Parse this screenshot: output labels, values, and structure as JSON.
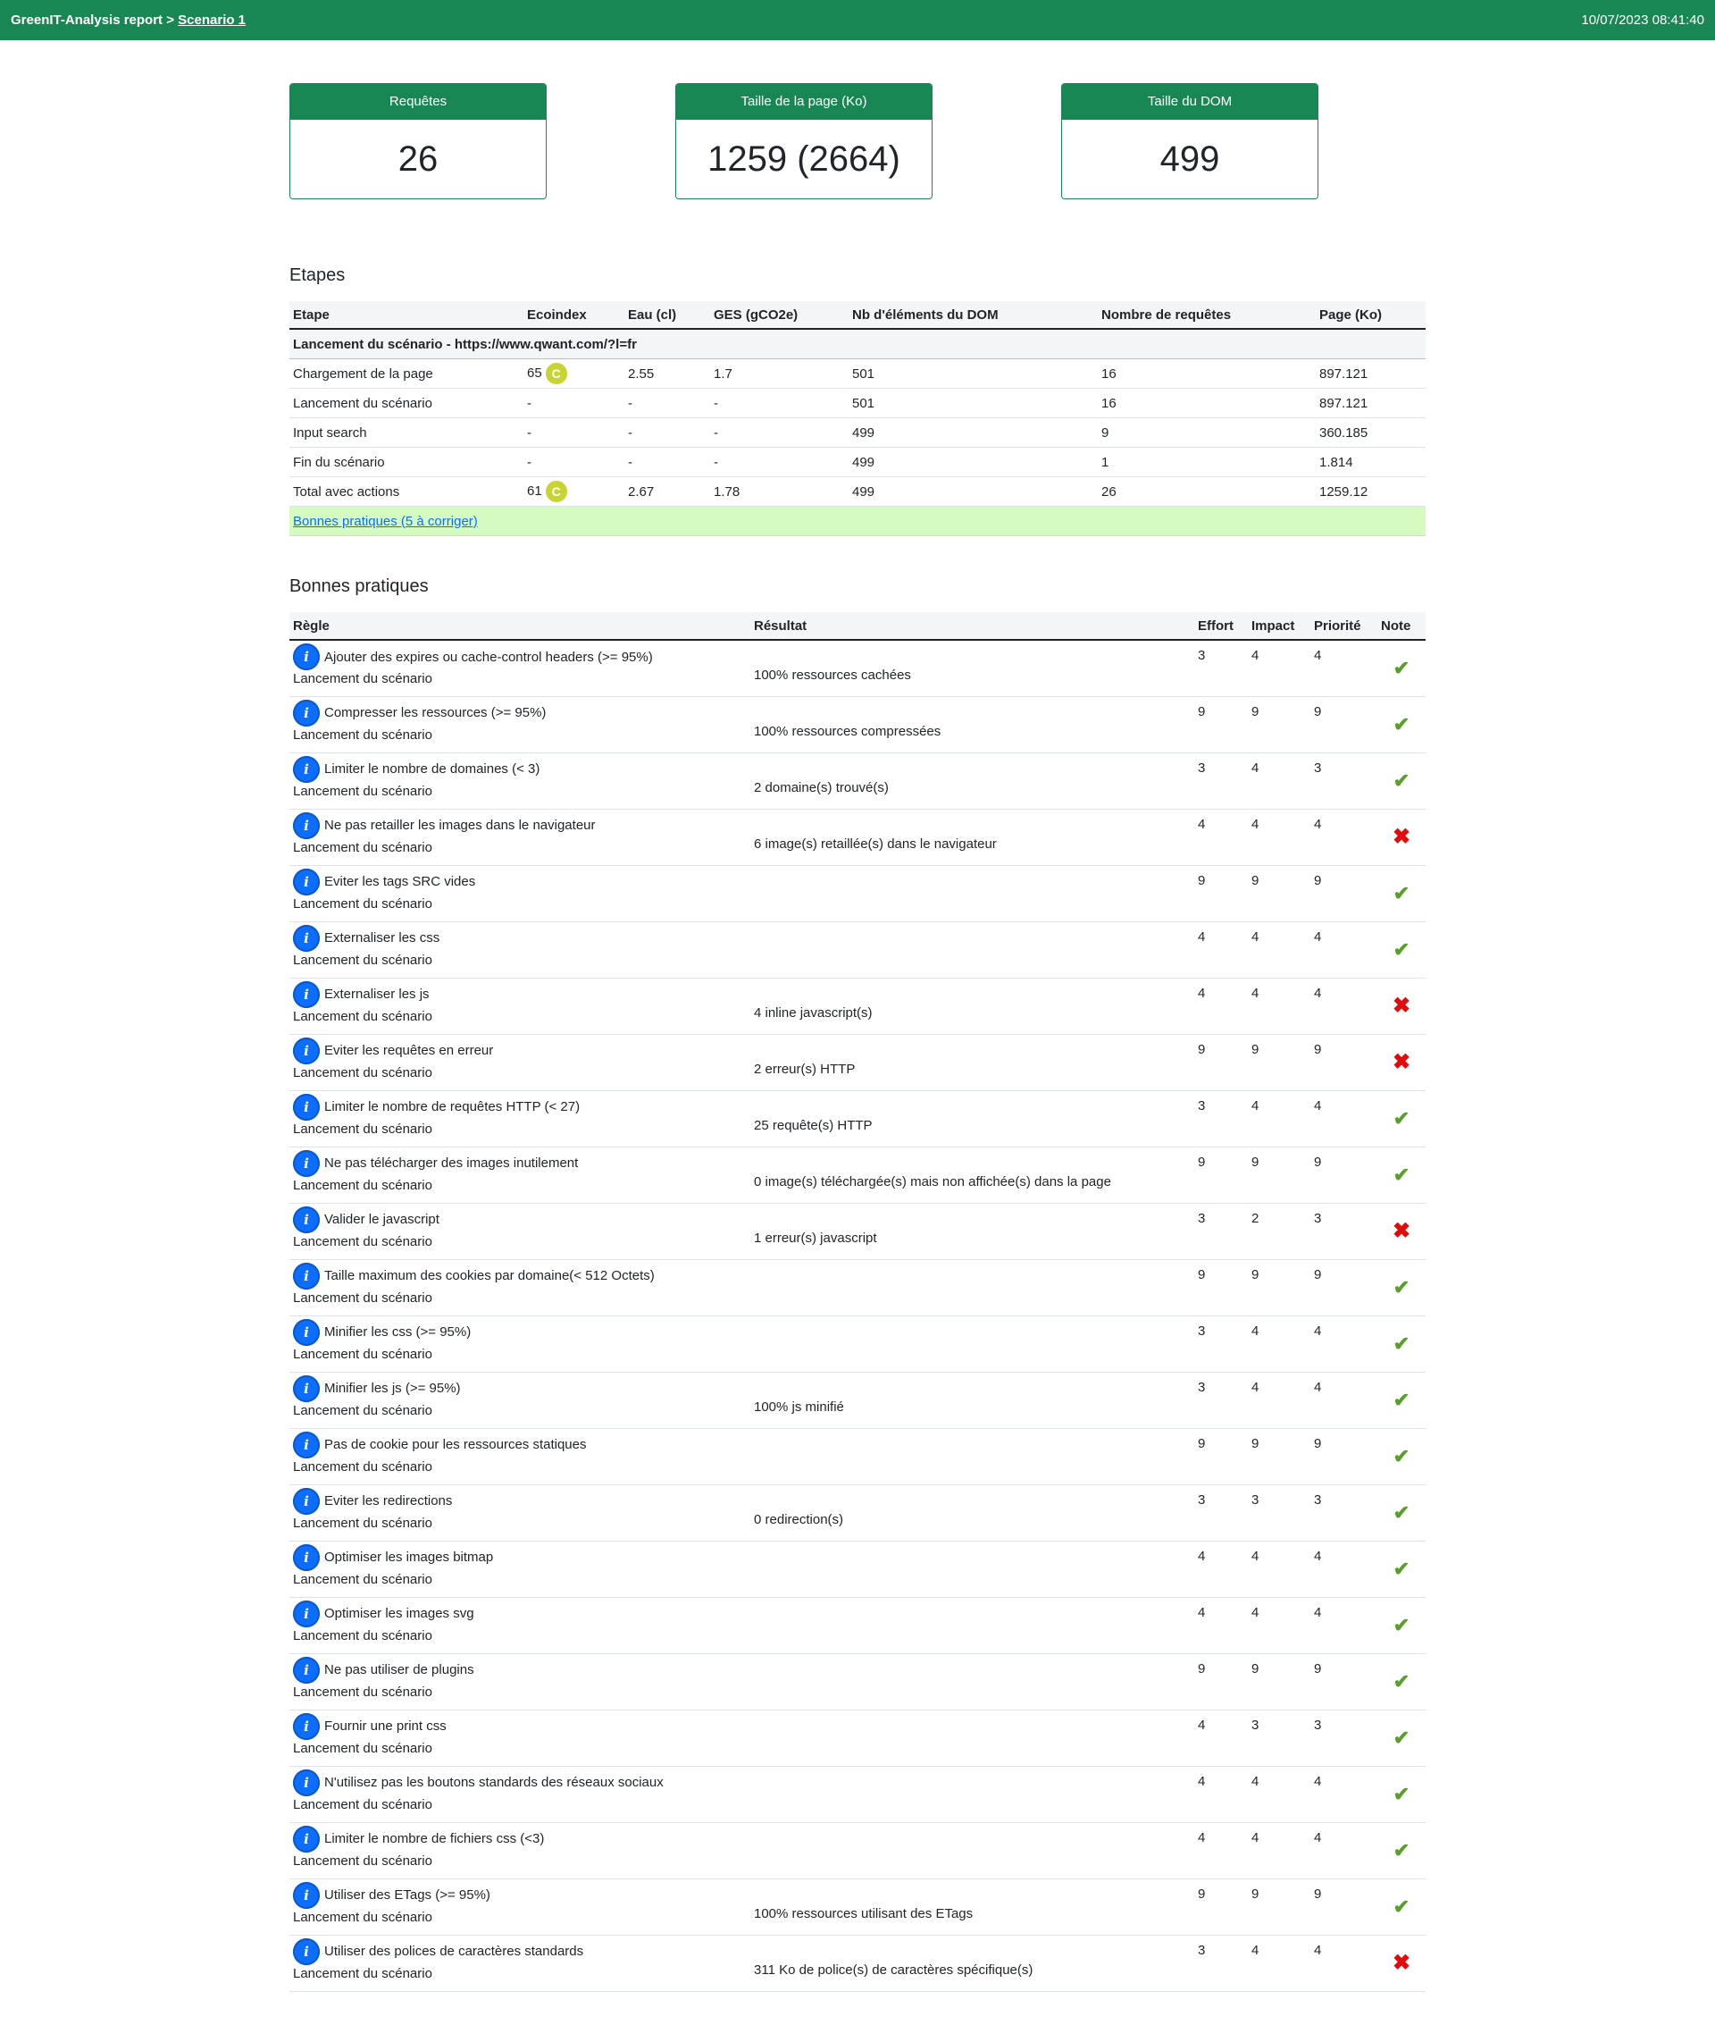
{
  "header": {
    "title": "GreenIT-Analysis report >",
    "scenario_link": "Scenario 1",
    "datetime": "10/07/2023 08:41:40"
  },
  "cards": {
    "requests": {
      "label": "Requêtes",
      "value": "26"
    },
    "page_size": {
      "label": "Taille de la page (Ko)",
      "value": "1259 (2664)"
    },
    "dom_size": {
      "label": "Taille du DOM",
      "value": "499"
    }
  },
  "etapes": {
    "title": "Etapes",
    "columns": [
      "Etape",
      "Ecoindex",
      "Eau (cl)",
      "GES (gCO2e)",
      "Nb d'éléments du DOM",
      "Nombre de requêtes",
      "Page (Ko)"
    ],
    "group_label": "Lancement du scénario - https://www.qwant.com/?l=fr",
    "rows": [
      {
        "etape": "Chargement de la page",
        "ecoindex": "65",
        "grade": "C",
        "eau": "2.55",
        "ges": "1.7",
        "dom": "501",
        "req": "16",
        "page": "897.121"
      },
      {
        "etape": "Lancement du scénario",
        "ecoindex": "-",
        "grade": "",
        "eau": "-",
        "ges": "-",
        "dom": "501",
        "req": "16",
        "page": "897.121"
      },
      {
        "etape": "Input search",
        "ecoindex": "-",
        "grade": "",
        "eau": "-",
        "ges": "-",
        "dom": "499",
        "req": "9",
        "page": "360.185"
      },
      {
        "etape": "Fin du scénario",
        "ecoindex": "-",
        "grade": "",
        "eau": "-",
        "ges": "-",
        "dom": "499",
        "req": "1",
        "page": "1.814"
      },
      {
        "etape": "Total avec actions",
        "ecoindex": "61",
        "grade": "C",
        "eau": "2.67",
        "ges": "1.78",
        "dom": "499",
        "req": "26",
        "page": "1259.12"
      }
    ],
    "bp_link": "Bonnes pratiques (5 à corriger)",
    "grade_color": "#c7d431"
  },
  "bonnes_pratiques": {
    "title": "Bonnes pratiques",
    "columns": [
      "Règle",
      "Résultat",
      "Effort",
      "Impact",
      "Priorité",
      "Note"
    ],
    "step": "Lancement du scénario",
    "rows": [
      {
        "rule": "Ajouter des expires ou cache-control headers (>= 95%)",
        "result": "100% ressources cachées",
        "effort": "3",
        "impact": "4",
        "priority": "4",
        "ok": true
      },
      {
        "rule": "Compresser les ressources (>= 95%)",
        "result": "100% ressources compressées",
        "effort": "9",
        "impact": "9",
        "priority": "9",
        "ok": true
      },
      {
        "rule": "Limiter le nombre de domaines (< 3)",
        "result": "2 domaine(s) trouvé(s)",
        "effort": "3",
        "impact": "4",
        "priority": "3",
        "ok": true
      },
      {
        "rule": "Ne pas retailler les images dans le navigateur",
        "result": "6 image(s) retaillée(s) dans le navigateur",
        "effort": "4",
        "impact": "4",
        "priority": "4",
        "ok": false
      },
      {
        "rule": "Eviter les tags SRC vides",
        "result": "",
        "effort": "9",
        "impact": "9",
        "priority": "9",
        "ok": true
      },
      {
        "rule": "Externaliser les css",
        "result": "",
        "effort": "4",
        "impact": "4",
        "priority": "4",
        "ok": true
      },
      {
        "rule": "Externaliser les js",
        "result": "4 inline javascript(s)",
        "effort": "4",
        "impact": "4",
        "priority": "4",
        "ok": false
      },
      {
        "rule": "Eviter les requêtes en erreur",
        "result": "2 erreur(s) HTTP",
        "effort": "9",
        "impact": "9",
        "priority": "9",
        "ok": false
      },
      {
        "rule": "Limiter le nombre de requêtes HTTP (< 27)",
        "result": "25 requête(s) HTTP",
        "effort": "3",
        "impact": "4",
        "priority": "4",
        "ok": true
      },
      {
        "rule": "Ne pas télécharger des images inutilement",
        "result": "0 image(s) téléchargée(s) mais non affichée(s) dans la page",
        "effort": "9",
        "impact": "9",
        "priority": "9",
        "ok": true
      },
      {
        "rule": "Valider le javascript",
        "result": "1 erreur(s) javascript",
        "effort": "3",
        "impact": "2",
        "priority": "3",
        "ok": false
      },
      {
        "rule": "Taille maximum des cookies par domaine(< 512 Octets)",
        "result": "",
        "effort": "9",
        "impact": "9",
        "priority": "9",
        "ok": true
      },
      {
        "rule": "Minifier les css (>= 95%)",
        "result": "",
        "effort": "3",
        "impact": "4",
        "priority": "4",
        "ok": true
      },
      {
        "rule": "Minifier les js (>= 95%)",
        "result": "100% js minifié",
        "effort": "3",
        "impact": "4",
        "priority": "4",
        "ok": true
      },
      {
        "rule": "Pas de cookie pour les ressources statiques",
        "result": "",
        "effort": "9",
        "impact": "9",
        "priority": "9",
        "ok": true
      },
      {
        "rule": "Eviter les redirections",
        "result": "0 redirection(s)",
        "effort": "3",
        "impact": "3",
        "priority": "3",
        "ok": true
      },
      {
        "rule": "Optimiser les images bitmap",
        "result": "",
        "effort": "4",
        "impact": "4",
        "priority": "4",
        "ok": true
      },
      {
        "rule": "Optimiser les images svg",
        "result": "",
        "effort": "4",
        "impact": "4",
        "priority": "4",
        "ok": true
      },
      {
        "rule": "Ne pas utiliser de plugins",
        "result": "",
        "effort": "9",
        "impact": "9",
        "priority": "9",
        "ok": true
      },
      {
        "rule": "Fournir une print css",
        "result": "",
        "effort": "4",
        "impact": "3",
        "priority": "3",
        "ok": true
      },
      {
        "rule": "N'utilisez pas les boutons standards des réseaux sociaux",
        "result": "",
        "effort": "4",
        "impact": "4",
        "priority": "4",
        "ok": true
      },
      {
        "rule": "Limiter le nombre de fichiers css (<3)",
        "result": "",
        "effort": "4",
        "impact": "4",
        "priority": "4",
        "ok": true
      },
      {
        "rule": "Utiliser des ETags (>= 95%)",
        "result": "100% ressources utilisant des ETags",
        "effort": "9",
        "impact": "9",
        "priority": "9",
        "ok": true
      },
      {
        "rule": "Utiliser des polices de caractères standards",
        "result": "311 Ko de police(s) de caractères spécifique(s)",
        "effort": "3",
        "impact": "4",
        "priority": "4",
        "ok": false
      }
    ],
    "check_color": "#5a9f2b",
    "cross_color": "#e20b0b"
  }
}
